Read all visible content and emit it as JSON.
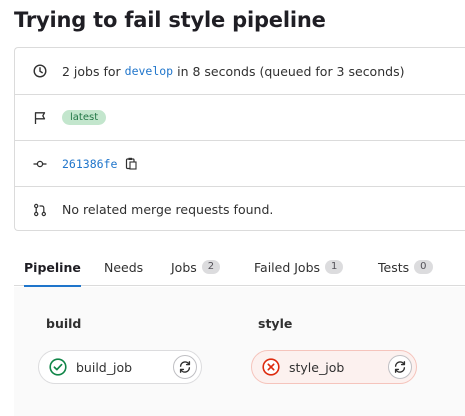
{
  "pipeline": {
    "title": "Trying to fail style pipeline"
  },
  "info": {
    "jobs_summary": {
      "prefix": "2 jobs for",
      "branch": "develop",
      "suffix": "in 8 seconds (queued for 3 seconds)"
    },
    "badge": "latest",
    "commit_sha": "261386fe",
    "merge_requests": "No related merge requests found."
  },
  "tabs": [
    {
      "label": "Pipeline",
      "active": true
    },
    {
      "label": "Needs"
    },
    {
      "label": "Jobs",
      "count": "2"
    },
    {
      "label": "Failed Jobs",
      "count": "1"
    },
    {
      "label": "Tests",
      "count": "0"
    }
  ],
  "stages": [
    {
      "name": "build",
      "job": {
        "name": "build_job",
        "status": "passed"
      }
    },
    {
      "name": "style",
      "job": {
        "name": "style_job",
        "status": "failed"
      }
    }
  ],
  "colors": {
    "link": "#1f75cb",
    "success": "#108548",
    "failed": "#dd2b0e",
    "latest_badge_bg": "#c3e6cd",
    "latest_badge_text": "#217645",
    "active_tab_underline": "#1f75cb"
  },
  "icons": {
    "duration": "clock-icon",
    "badge": "flag-icon",
    "commit": "commit-icon",
    "copy": "clipboard-icon",
    "merge_request": "merge-request-icon",
    "passed": "check-circle-icon",
    "failed": "x-circle-icon",
    "retry": "retry-icon"
  }
}
